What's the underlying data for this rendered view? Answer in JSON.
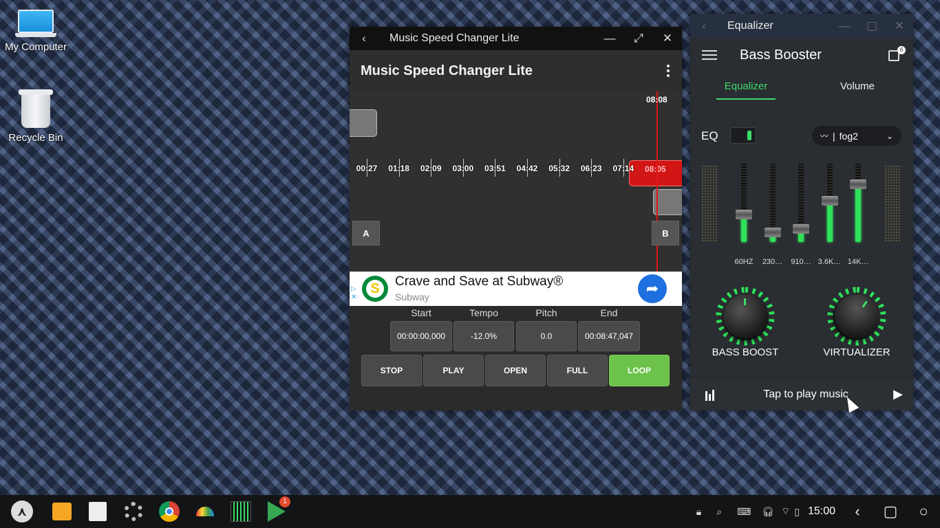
{
  "desktop": {
    "icons": [
      {
        "label": "My Computer",
        "icon": "laptop-icon"
      },
      {
        "label": "Recycle Bin",
        "icon": "recycle-bin-icon"
      }
    ]
  },
  "speed_app": {
    "window_title": "Music Speed Changer Lite",
    "app_title": "Music Speed Changer Lite",
    "playhead_time": "08:08",
    "ticks": [
      "00:27",
      "01:18",
      "02:09",
      "03:00",
      "03:51",
      "04:42",
      "05:32",
      "06:23",
      "07:14",
      "08:05"
    ],
    "marker_a": "A",
    "marker_b": "B",
    "ad": {
      "headline": "Crave and Save at Subway®",
      "advertiser": "Subway"
    },
    "params": [
      {
        "label": "Start",
        "value": "00:00:00,000"
      },
      {
        "label": "Tempo",
        "value": "-12.0%"
      },
      {
        "label": "Pitch",
        "value": "0.0"
      },
      {
        "label": "End",
        "value": "00:08:47,047"
      }
    ],
    "controls": [
      "STOP",
      "PLAY",
      "OPEN",
      "FULL",
      "LOOP"
    ],
    "active_control_color": "#6cc24a"
  },
  "eq_app": {
    "window_title": "Equalizer",
    "app_title": "Bass Booster",
    "gift_badge": "6",
    "tabs": [
      "Equalizer",
      "Volume"
    ],
    "active_tab": "Equalizer",
    "eq_label": "EQ",
    "eq_enabled": true,
    "preset": "fog2",
    "bands": [
      {
        "label": "60HZ",
        "level": 0.32
      },
      {
        "label": "230…",
        "level": 0.08
      },
      {
        "label": "910…",
        "level": 0.13
      },
      {
        "label": "3.6K…",
        "level": 0.5
      },
      {
        "label": "14K…",
        "level": 0.72
      }
    ],
    "knobs": [
      "BASS BOOST",
      "VIRTUALIZER"
    ],
    "player_text": "Tap to play music",
    "accent": "#3ddc6a"
  },
  "taskbar": {
    "apps": [
      "start-icon",
      "files-icon",
      "notes-icon",
      "settings-icon",
      "chrome-icon",
      "lens-icon",
      "equalizer-app-icon",
      "play-store-icon"
    ],
    "play_store_badge": "1",
    "clock": "15:00"
  }
}
